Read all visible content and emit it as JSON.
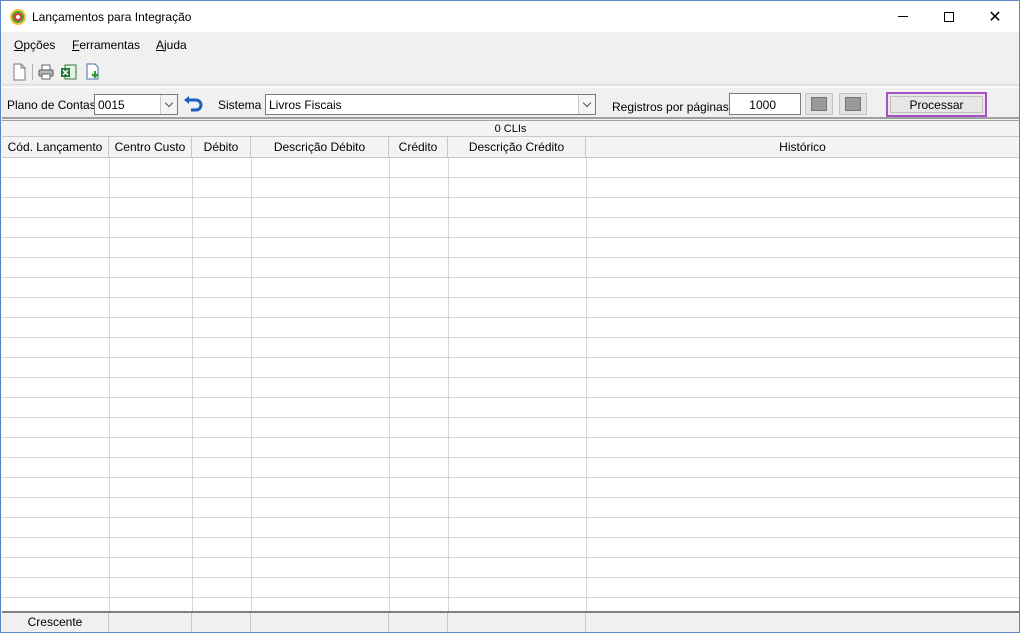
{
  "window": {
    "title": "Lançamentos para Integração"
  },
  "menu": {
    "items": [
      {
        "label": "Opções",
        "underline": "O",
        "rest": "pções"
      },
      {
        "label": "Ferramentas",
        "underline": "F",
        "rest": "erramentas"
      },
      {
        "label": "Ajuda",
        "underline": "A",
        "rest": "juda"
      }
    ]
  },
  "toolbar": {
    "icons": [
      "new-document-icon",
      "print-icon",
      "excel-export-icon",
      "import-download-icon"
    ]
  },
  "filters": {
    "plano_label": "Plano de Contas",
    "plano_value": "0015",
    "sistema_label": "Sistema",
    "sistema_value": "Livros Fiscais",
    "registros_label": "Registros por páginas:",
    "registros_value": "1000",
    "processar_label": "Processar"
  },
  "grid": {
    "group_header": "0 CLIs",
    "columns": [
      "Cód. Lançamento",
      "Centro Custo",
      "Débito",
      "Descrição Débito",
      "Crédito",
      "Descrição Crédito",
      "Histórico"
    ],
    "footer": [
      "Crescente",
      "",
      "",
      "",
      "",
      "",
      ""
    ]
  },
  "colors": {
    "accent_border": "#a452c6",
    "window_border": "#5b87c7"
  }
}
